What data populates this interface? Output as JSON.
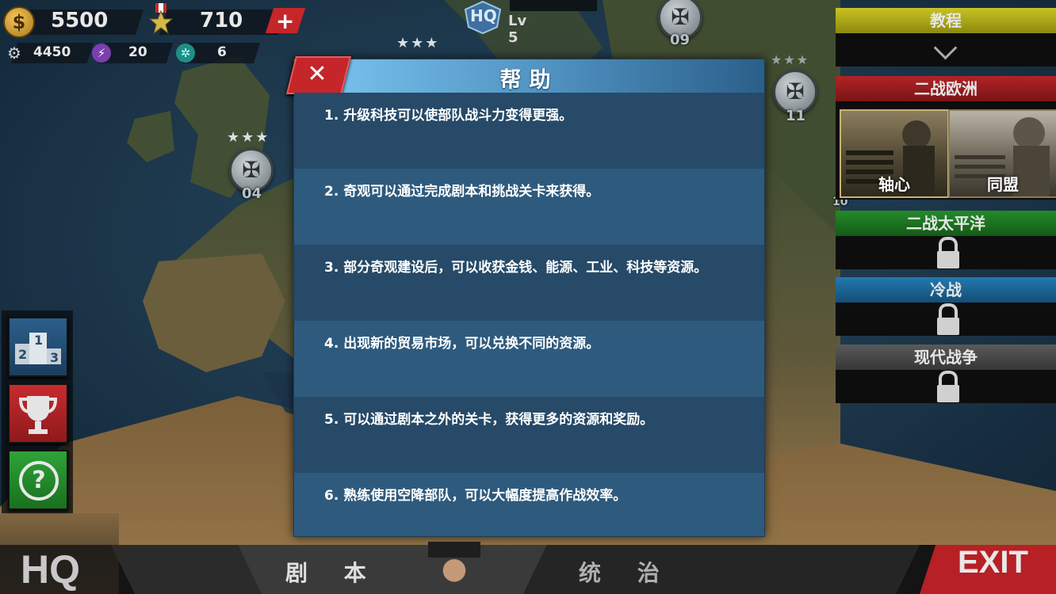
{
  "resources": {
    "money": "5500",
    "medals": "710",
    "industry": "4450",
    "energy": "20",
    "tech": "6"
  },
  "hq": {
    "badge": "HQ",
    "level": "Lv 5"
  },
  "map_nodes": [
    {
      "number": "04"
    },
    {
      "number": "09"
    },
    {
      "number": "11"
    },
    {
      "number": "10"
    }
  ],
  "dialog": {
    "title": "帮助",
    "close_glyph": "✕",
    "tips": [
      "1.  升级科技可以使部队战斗力变得更强。",
      "2.  奇观可以通过完成剧本和挑战关卡来获得。",
      "3.  部分奇观建设后，可以收获金钱、能源、工业、科技等资源。",
      "4.  出现新的贸易市场，可以兑换不同的资源。",
      "5.  可以通过剧本之外的关卡，获得更多的资源和奖励。",
      "6.  熟练使用空降部队，可以大幅度提高作战效率。"
    ]
  },
  "right_panel": {
    "tutorial": "教程",
    "ww2_europe": "二战欧洲",
    "axis": "轴心",
    "allies": "同盟",
    "ww2_pacific": "二战太平洋",
    "cold_war": "冷战",
    "modern_war": "现代战争"
  },
  "left_buttons": {
    "ranking_digits": [
      "1",
      "2",
      "3"
    ],
    "help_glyph": "?"
  },
  "bottom": {
    "hq": "HQ",
    "scenario": "剧 本",
    "rule": "统 治",
    "exit": "EXIT"
  },
  "colors": {
    "dialog_header": "#7fc8f4",
    "tutorial_band": "#b9b51c",
    "europe_band": "#a91e20",
    "pacific_band": "#1f7a23",
    "coldwar_band": "#1e6fa0",
    "modern_band": "#505050",
    "exit_red": "#b72025"
  }
}
